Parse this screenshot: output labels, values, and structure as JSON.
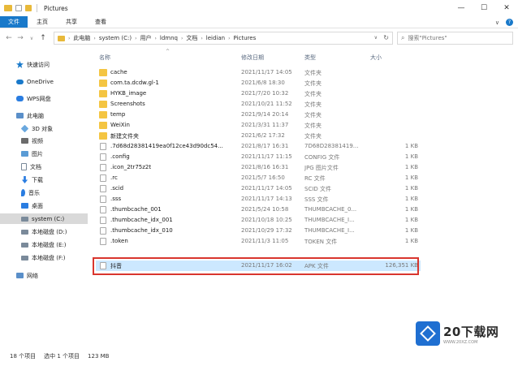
{
  "window": {
    "title": "Pictures",
    "minimize_glyph": "—",
    "maximize_glyph": "☐",
    "close_glyph": "✕"
  },
  "ribbon": {
    "tabs": [
      "文件",
      "主页",
      "共享",
      "查看"
    ],
    "expand_glyph": "∨",
    "help_glyph": "?"
  },
  "nav": {
    "back_glyph": "←",
    "forward_glyph": "→",
    "recent_glyph": "∨",
    "up_glyph": "↑"
  },
  "address": {
    "crumbs": [
      "此电脑",
      "system (C:)",
      "用户",
      "ldmnq",
      "文档",
      "leidian",
      "Pictures"
    ],
    "separator": "›",
    "dropdown_glyph": "∨",
    "refresh_glyph": "↻"
  },
  "search": {
    "glyph": "⌕",
    "placeholder": "搜索\"Pictures\""
  },
  "sidebar": {
    "items": [
      {
        "label": "快速访问",
        "icon": "star-icon",
        "color": "#1979ca"
      },
      {
        "label": "OneDrive",
        "icon": "cloud-icon",
        "color": "#1979ca"
      },
      {
        "label": "WPS网盘",
        "icon": "cloud-drive-icon",
        "color": "#2a7de1"
      },
      {
        "label": "此电脑",
        "icon": "computer-icon",
        "color": "#5a8fc9"
      },
      {
        "label": "3D 对象",
        "icon": "cube-icon",
        "color": "#6aa8de"
      },
      {
        "label": "视频",
        "icon": "video-icon",
        "color": "#6b6b6b"
      },
      {
        "label": "图片",
        "icon": "image-icon",
        "color": "#5a9bd5"
      },
      {
        "label": "文档",
        "icon": "document-icon",
        "color": "#7a8a9a"
      },
      {
        "label": "下载",
        "icon": "download-icon",
        "color": "#2a7de1"
      },
      {
        "label": "音乐",
        "icon": "music-icon",
        "color": "#2a7de1"
      },
      {
        "label": "桌面",
        "icon": "desktop-icon",
        "color": "#2a7de1"
      },
      {
        "label": "system (C:)",
        "icon": "drive-icon",
        "color": "#7a8a9a"
      },
      {
        "label": "本地磁盘 (D:)",
        "icon": "drive-icon",
        "color": "#7a8a9a"
      },
      {
        "label": "本地磁盘 (E:)",
        "icon": "drive-icon",
        "color": "#7a8a9a"
      },
      {
        "label": "本地磁盘 (F:)",
        "icon": "drive-icon",
        "color": "#7a8a9a"
      },
      {
        "label": "网络",
        "icon": "network-icon",
        "color": "#5a8fc9"
      }
    ]
  },
  "columns": {
    "sort_glyph": "^",
    "name": "名称",
    "date": "修改日期",
    "type": "类型",
    "size": "大小"
  },
  "files": [
    {
      "name": "cache",
      "date": "2021/11/17 14:05",
      "type": "文件夹",
      "size": "",
      "kind": "folder"
    },
    {
      "name": "com.ta.dcdw.gl-1",
      "date": "2021/6/8 18:30",
      "type": "文件夹",
      "size": "",
      "kind": "folder"
    },
    {
      "name": "HYKB_image",
      "date": "2021/7/20 10:32",
      "type": "文件夹",
      "size": "",
      "kind": "folder"
    },
    {
      "name": "Screenshots",
      "date": "2021/10/21 11:52",
      "type": "文件夹",
      "size": "",
      "kind": "folder"
    },
    {
      "name": "temp",
      "date": "2021/9/14 20:14",
      "type": "文件夹",
      "size": "",
      "kind": "folder"
    },
    {
      "name": "WeiXin",
      "date": "2021/3/31 11:37",
      "type": "文件夹",
      "size": "",
      "kind": "folder"
    },
    {
      "name": "新建文件夹",
      "date": "2021/6/2 17:32",
      "type": "文件夹",
      "size": "",
      "kind": "folder"
    },
    {
      "name": ".7d68d28381419ea0f12ce43d90dc54...",
      "date": "2021/8/17 16:31",
      "type": "7D68D28381419...",
      "size": "1 KB",
      "kind": "doc"
    },
    {
      "name": ".config",
      "date": "2021/11/17 11:15",
      "type": "CONFIG 文件",
      "size": "1 KB",
      "kind": "doc"
    },
    {
      "name": ".icon_2tr75z2t",
      "date": "2021/8/16 16:31",
      "type": "JPG 图片文件",
      "size": "1 KB",
      "kind": "doc"
    },
    {
      "name": ".rc",
      "date": "2021/5/7 16:50",
      "type": "RC 文件",
      "size": "1 KB",
      "kind": "doc"
    },
    {
      "name": ".scid",
      "date": "2021/11/17 14:05",
      "type": "SCID 文件",
      "size": "1 KB",
      "kind": "doc"
    },
    {
      "name": ".sss",
      "date": "2021/11/17 14:13",
      "type": "SSS 文件",
      "size": "1 KB",
      "kind": "doc"
    },
    {
      "name": ".thumbcache_001",
      "date": "2021/5/24 10:58",
      "type": "THUMBCACHE_0...",
      "size": "1 KB",
      "kind": "doc"
    },
    {
      "name": ".thumbcache_idx_001",
      "date": "2021/10/18 10:25",
      "type": "THUMBCACHE_I...",
      "size": "1 KB",
      "kind": "doc"
    },
    {
      "name": ".thumbcache_idx_010",
      "date": "2021/10/29 17:32",
      "type": "THUMBCACHE_I...",
      "size": "1 KB",
      "kind": "doc"
    },
    {
      "name": ".token",
      "date": "2021/11/3 11:05",
      "type": "TOKEN 文件",
      "size": "1 KB",
      "kind": "doc"
    },
    {
      "name": "抖音",
      "date": "2021/11/17 16:02",
      "type": "APK 文件",
      "size": "126,351 KB",
      "kind": "doc",
      "selected": true
    }
  ],
  "status": {
    "items": "18 个项目",
    "selected": "选中 1 个项目",
    "size": "123 MB",
    "view_details_glyph": "☰",
    "view_icons_glyph": "▦"
  },
  "watermark": {
    "main": "20下载网",
    "sub": "WWW.20XZ.COM"
  }
}
